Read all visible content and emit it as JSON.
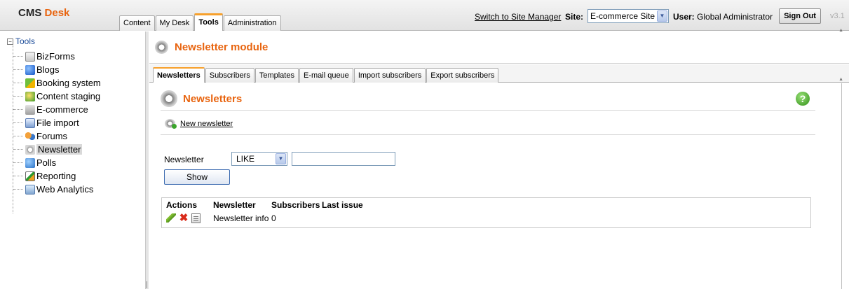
{
  "header": {
    "logo_prefix": "CMS",
    "logo_suffix": "Desk",
    "tabs": [
      "Content",
      "My Desk",
      "Tools",
      "Administration"
    ],
    "active_tab": "Tools",
    "switch_link": "Switch to Site Manager",
    "site_label": "Site:",
    "site_value": "E-commerce Site",
    "user_label": "User:",
    "user_name": "Global Administrator",
    "signout_label": "Sign Out",
    "version": "v3.1"
  },
  "tree": {
    "root": "Tools",
    "items": [
      {
        "label": "BizForms",
        "icon": "bizforms-icon"
      },
      {
        "label": "Blogs",
        "icon": "blogs-icon"
      },
      {
        "label": "Booking system",
        "icon": "booking-icon"
      },
      {
        "label": "Content staging",
        "icon": "content-staging-icon"
      },
      {
        "label": "E-commerce",
        "icon": "ecommerce-icon"
      },
      {
        "label": "File import",
        "icon": "file-import-icon"
      },
      {
        "label": "Forums",
        "icon": "forums-icon"
      },
      {
        "label": "Newsletter",
        "icon": "newsletter-icon",
        "selected": true
      },
      {
        "label": "Polls",
        "icon": "polls-icon"
      },
      {
        "label": "Reporting",
        "icon": "reporting-icon"
      },
      {
        "label": "Web Analytics",
        "icon": "web-analytics-icon"
      }
    ]
  },
  "module": {
    "title": "Newsletter module",
    "subtabs": [
      "Newsletters",
      "Subscribers",
      "Templates",
      "E-mail queue",
      "Import subscribers",
      "Export subscribers"
    ],
    "active_subtab": "Newsletters"
  },
  "page": {
    "title": "Newsletters",
    "new_link": "New newsletter",
    "filter": {
      "label": "Newsletter",
      "operator": "LIKE",
      "value": "",
      "show_label": "Show"
    },
    "grid": {
      "columns": [
        "Actions",
        "Newsletter",
        "Subscribers",
        "Last issue"
      ],
      "rows": [
        {
          "newsletter": "Newsletter info",
          "subscribers": "0",
          "last_issue": ""
        }
      ]
    }
  },
  "colors": {
    "accent_orange": "#e8640f",
    "tab_highlight": "#f7a02b"
  }
}
